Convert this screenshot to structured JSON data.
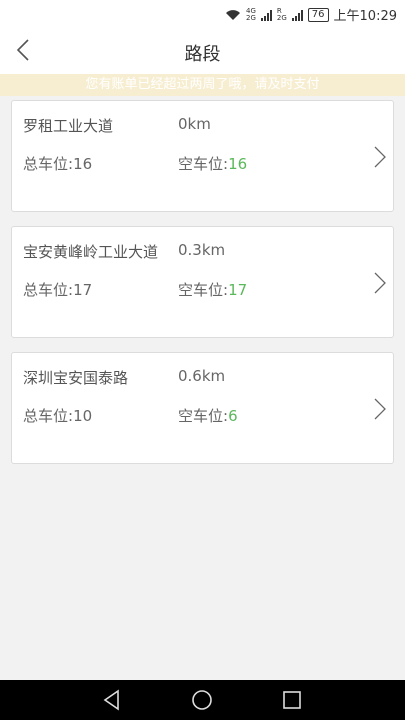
{
  "status": {
    "time": "上午10:29",
    "battery": "76",
    "net1": "4G",
    "net2": "2G",
    "net3": "R",
    "net4": "2G"
  },
  "header": {
    "title": "路段"
  },
  "notice": "您有账单已经超过两周了哦，请及时支付",
  "labels": {
    "total": "总车位:",
    "free": "空车位:"
  },
  "roads": [
    {
      "name": "罗租工业大道",
      "distance": "0km",
      "total": "16",
      "free": "16"
    },
    {
      "name": "宝安黄峰岭工业大道",
      "distance": "0.3km",
      "total": "17",
      "free": "17"
    },
    {
      "name": "深圳宝安国泰路",
      "distance": "0.6km",
      "total": "10",
      "free": "6"
    }
  ],
  "colors": {
    "accent_green": "#5cb85c",
    "notice_bg": "#f7eed2"
  },
  "icons": {
    "back": "back-arrow-icon",
    "row": "chevron-right-icon"
  }
}
